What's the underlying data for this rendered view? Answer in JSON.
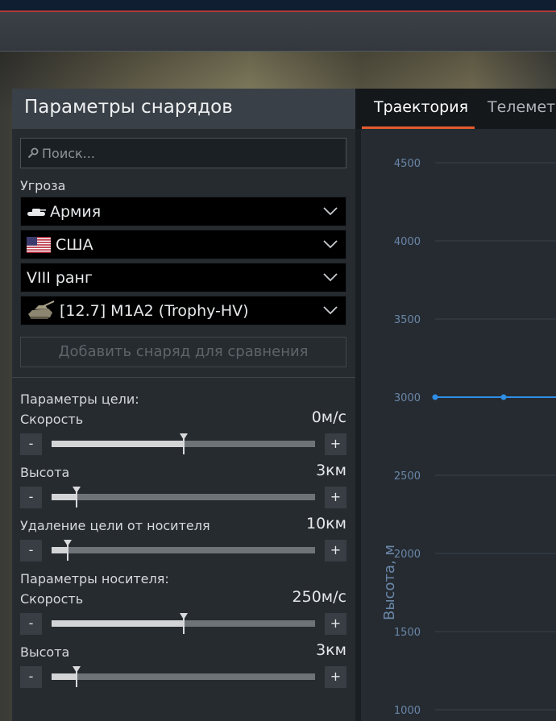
{
  "panel": {
    "title": "Параметры снарядов",
    "search_placeholder": "Поиск..."
  },
  "threat": {
    "label": "Угроза",
    "category": "Армия",
    "nation": "США",
    "rank": "VIII ранг",
    "vehicle": "[12.7] M1A2 (Trophy-HV)"
  },
  "compare_button": "Добавить снаряд для сравнения",
  "target_params": {
    "heading": "Параметры цели:",
    "speed": {
      "label": "Скорость",
      "value": "0м/с",
      "fraction": 0.5
    },
    "altitude": {
      "label": "Высота",
      "value": "3км",
      "fraction": 0.095
    },
    "distance": {
      "label": "Удаление цели от носителя",
      "value": "10км",
      "fraction": 0.06
    }
  },
  "carrier_params": {
    "heading": "Параметры носителя:",
    "speed": {
      "label": "Скорость",
      "value": "250м/с",
      "fraction": 0.5
    },
    "altitude": {
      "label": "Высота",
      "value": "3км",
      "fraction": 0.095
    }
  },
  "buttons": {
    "minus": "-",
    "plus": "+"
  },
  "tabs": {
    "trajectory": "Траектория",
    "telemetry": "Телеметр"
  },
  "chart_data": {
    "type": "line",
    "ylabel": "Высота, м",
    "y_ticks": [
      "4500",
      "4000",
      "3500",
      "3000",
      "2500",
      "2000",
      "1500",
      "1000"
    ],
    "ylim": [
      1000,
      4500
    ],
    "series": [
      {
        "color": "#2f8fe8",
        "points": [
          3000,
          3000,
          3000
        ]
      }
    ]
  },
  "colors": {
    "accent_tab": "#e45b2e",
    "series_blue": "#2f8fe8",
    "axis_text": "#6a86a8"
  }
}
